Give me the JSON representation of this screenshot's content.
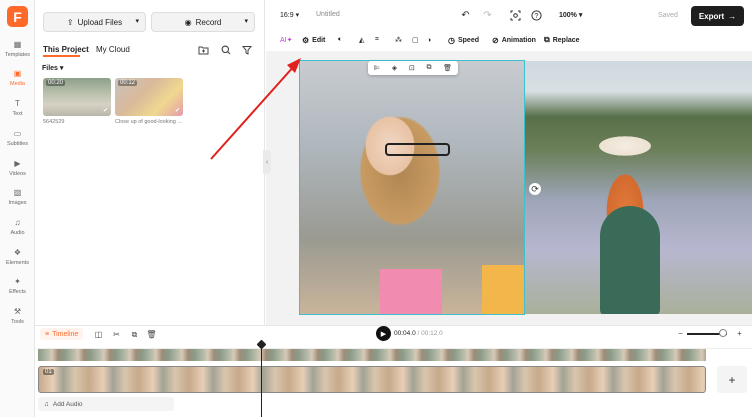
{
  "app": {
    "logo_letter": "F",
    "accent": "#ff6a2b"
  },
  "rail": [
    {
      "label": "Templates",
      "icon": "templates-icon",
      "glyph": "▦"
    },
    {
      "label": "Media",
      "icon": "media-icon",
      "glyph": "▣"
    },
    {
      "label": "Text",
      "icon": "text-icon",
      "glyph": "T"
    },
    {
      "label": "Subtitles",
      "icon": "subtitles-icon",
      "glyph": "▭"
    },
    {
      "label": "Videos",
      "icon": "videos-icon",
      "glyph": "▶"
    },
    {
      "label": "Images",
      "icon": "images-icon",
      "glyph": "▨"
    },
    {
      "label": "Audio",
      "icon": "audio-icon",
      "glyph": "♫"
    },
    {
      "label": "Elements",
      "icon": "elements-icon",
      "glyph": "❖"
    },
    {
      "label": "Effects",
      "icon": "effects-icon",
      "glyph": "✦"
    },
    {
      "label": "Tools",
      "icon": "tools-icon",
      "glyph": "⚒"
    }
  ],
  "panel": {
    "upload_label": "Upload Files",
    "record_label": "Record",
    "tabs": [
      "This Project",
      "My Cloud"
    ],
    "files_label": "Files",
    "media": [
      {
        "duration": "00:20",
        "caption": "5642529"
      },
      {
        "duration": "00:12",
        "caption": "Close up of good-looking ..."
      }
    ]
  },
  "topbar": {
    "aspect_ratio": "16:9",
    "title": "Untitled",
    "zoom": "100%",
    "saved": "Saved",
    "export_label": "Export"
  },
  "editbar": {
    "ai_label": "AI",
    "edit_label": "Edit",
    "speed_label": "Speed",
    "animation_label": "Animation",
    "replace_label": "Replace"
  },
  "timeline": {
    "label": "Timeline",
    "current_time": "00:04.0",
    "total_time": "/ 00:12.0",
    "clip_label": "01",
    "add_audio_label": "Add Audio",
    "zoom_level": 0.9
  }
}
